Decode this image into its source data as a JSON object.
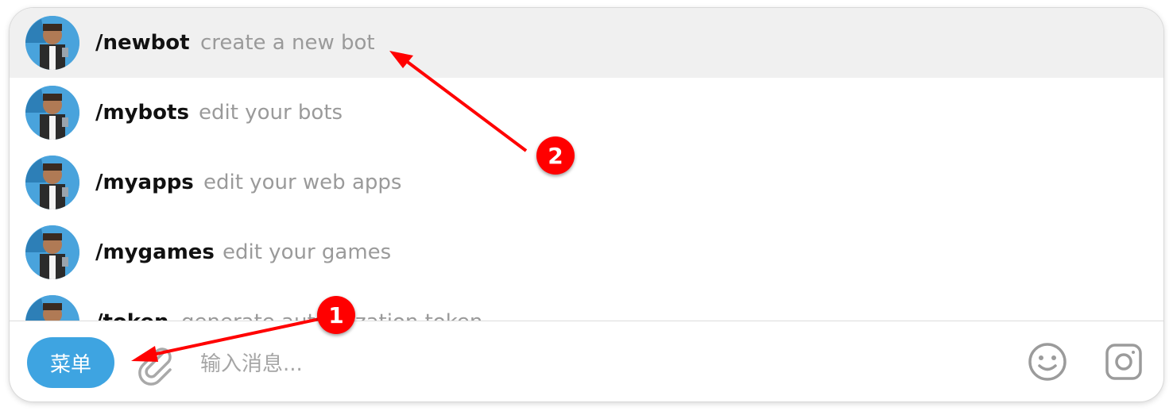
{
  "commands": [
    {
      "name": "/newbot",
      "desc": "create a new bot",
      "active": true
    },
    {
      "name": "/mybots",
      "desc": "edit your bots",
      "active": false
    },
    {
      "name": "/myapps",
      "desc": "edit your web apps",
      "active": false
    },
    {
      "name": "/mygames",
      "desc": "edit your games",
      "active": false
    },
    {
      "name": "/token",
      "desc": "generate authorization token",
      "active": false
    }
  ],
  "composer": {
    "menu_label": "菜单",
    "input_placeholder": "输入消息...",
    "attach_icon": "paperclip-icon",
    "emoji_icon": "smiley-icon",
    "camera_icon": "instagram-camera-icon"
  },
  "annotations": [
    {
      "label": "1",
      "color": "#ff0000"
    },
    {
      "label": "2",
      "color": "#ff0000"
    }
  ],
  "colors": {
    "accent": "#3ea4e1",
    "highlight_row": "#f0f0f0",
    "annotation": "#ff0000"
  }
}
